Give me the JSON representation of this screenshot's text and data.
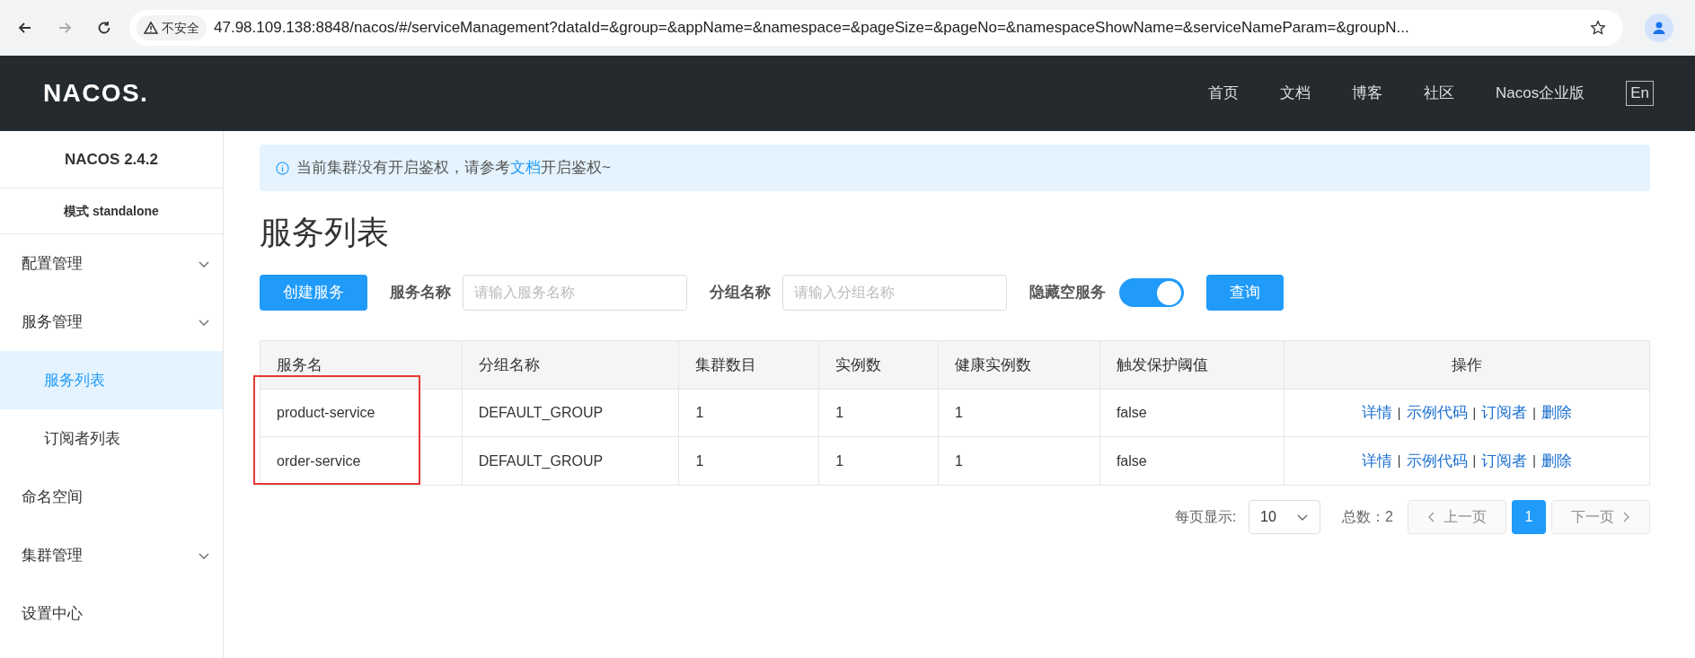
{
  "browser": {
    "security_label": "不安全",
    "url": "47.98.109.138:8848/nacos/#/serviceManagement?dataId=&group=&appName=&namespace=&pageSize=&pageNo=&namespaceShowName=&serviceNameParam=&groupN...",
    "back_disabled": false,
    "forward_disabled": true
  },
  "header": {
    "logo": "NACOS.",
    "nav": [
      "首页",
      "文档",
      "博客",
      "社区",
      "Nacos企业版"
    ],
    "language": "En"
  },
  "sidebar": {
    "version": "NACOS 2.4.2",
    "mode": "模式 standalone",
    "items": [
      {
        "label": "配置管理",
        "expandable": true,
        "selected": false
      },
      {
        "label": "服务管理",
        "expandable": true,
        "selected": false,
        "children": [
          {
            "label": "服务列表",
            "selected": true
          },
          {
            "label": "订阅者列表",
            "selected": false
          }
        ]
      },
      {
        "label": "命名空间",
        "expandable": false,
        "selected": false
      },
      {
        "label": "集群管理",
        "expandable": true,
        "selected": false
      },
      {
        "label": "设置中心",
        "expandable": false,
        "selected": false
      }
    ]
  },
  "notice": {
    "text_before": "当前集群没有开启鉴权，请参考",
    "link": "文档",
    "text_after": "开启鉴权~"
  },
  "title": "服务列表",
  "toolbar": {
    "create_button": "创建服务",
    "service_name_label": "服务名称",
    "service_name_placeholder": "请输入服务名称",
    "group_name_label": "分组名称",
    "group_name_placeholder": "请输入分组名称",
    "hide_empty_label": "隐藏空服务",
    "hide_empty_on": true,
    "query_button": "查询"
  },
  "table": {
    "columns": [
      "服务名",
      "分组名称",
      "集群数目",
      "实例数",
      "健康实例数",
      "触发保护阈值",
      "操作"
    ],
    "rows": [
      {
        "cells": [
          "product-service",
          "DEFAULT_GROUP",
          "1",
          "1",
          "1",
          "false"
        ],
        "actions": [
          "详情",
          "示例代码",
          "订阅者",
          "删除"
        ],
        "separator": "|"
      },
      {
        "cells": [
          "order-service",
          "DEFAULT_GROUP",
          "1",
          "1",
          "1",
          "false"
        ],
        "actions": [
          "详情",
          "示例代码",
          "订阅者",
          "删除"
        ],
        "separator": "|"
      }
    ]
  },
  "pagination": {
    "page_size_label": "每页显示:",
    "page_size": "10",
    "total": "总数：2",
    "prev": "上一页",
    "prev_disabled": true,
    "pages": [
      {
        "label": "1",
        "selected": true
      }
    ],
    "next": "下一页",
    "next_disabled": true
  }
}
